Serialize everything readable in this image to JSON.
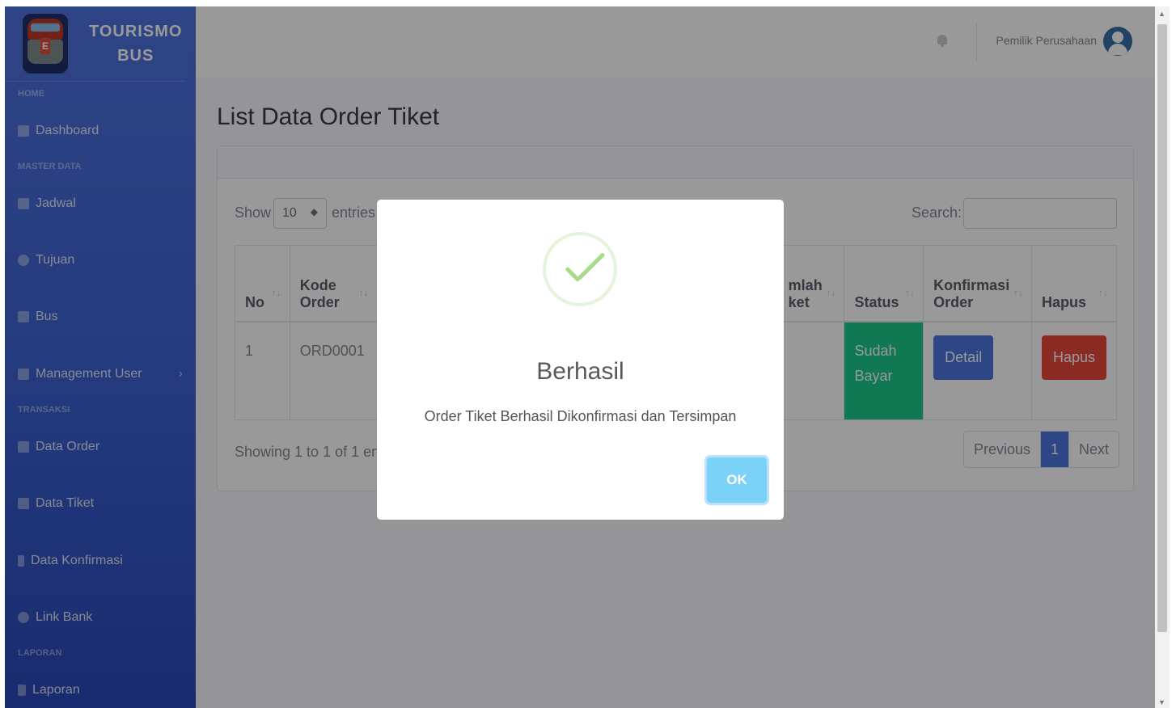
{
  "brand": {
    "line1": "TOURISMO",
    "line2": "BUS"
  },
  "sidebar": {
    "headings": [
      "HOME",
      "MASTER DATA",
      "TRANSAKSI",
      "LAPORAN"
    ],
    "items": [
      {
        "label": "Dashboard",
        "icon": "tachometer-icon"
      },
      {
        "label": "Jadwal",
        "icon": "calendar-icon"
      },
      {
        "label": "Tujuan",
        "icon": "compass-icon"
      },
      {
        "label": "Bus",
        "icon": "bus-icon"
      },
      {
        "label": "Management User",
        "icon": "users-icon"
      },
      {
        "label": "Data Order",
        "icon": "table-icon"
      },
      {
        "label": "Data Tiket",
        "icon": "grid-icon"
      },
      {
        "label": "Data Konfirmasi",
        "icon": "pointer-icon"
      },
      {
        "label": "Link Bank",
        "icon": "link-icon"
      },
      {
        "label": "Laporan",
        "icon": "file-icon"
      }
    ]
  },
  "topbar": {
    "user_name": "Pemilik Perusahaan"
  },
  "main": {
    "title": "List Data Order Tiket",
    "show_label": "Show",
    "page_size": "10",
    "entries_label": "entries",
    "search_label": "Search:",
    "search_value": "",
    "table": {
      "headers": [
        "No",
        "Kode Order",
        "mlah ket",
        "Status",
        "Konfirmasi Order",
        "Hapus"
      ],
      "rows": [
        {
          "no": "1",
          "kode": "ORD0001",
          "jumlah": "",
          "status": "Sudah Bayar",
          "detail": "Detail",
          "hapus": "Hapus"
        }
      ]
    },
    "showing": "Showing 1 to 1 of 1 ent",
    "pager": {
      "prev": "Previous",
      "current": "1",
      "next": "Next"
    }
  },
  "modal": {
    "title": "Berhasil",
    "text": "Order Tiket Berhasil Dikonfirmasi dan Tersimpan",
    "ok": "OK",
    "accent": "#a5dc86"
  },
  "colors": {
    "primary": "#4e73df",
    "success": "#1cc88a",
    "danger": "#e74a3b"
  }
}
